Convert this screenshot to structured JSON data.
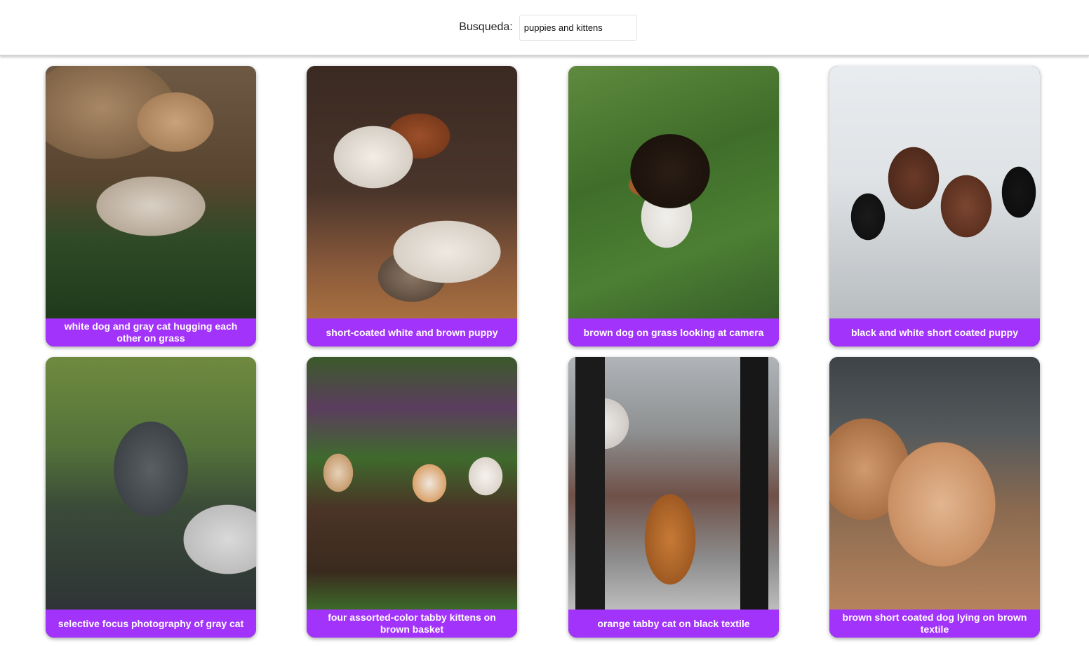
{
  "search": {
    "label": "Busqueda:",
    "value": "puppies and kittens"
  },
  "cards": [
    {
      "caption": "white dog and gray cat hugging each other on grass"
    },
    {
      "caption": "short-coated white and brown puppy"
    },
    {
      "caption": "brown dog on grass looking at camera"
    },
    {
      "caption": "black and white short coated puppy"
    },
    {
      "caption": "selective focus photography of gray cat"
    },
    {
      "caption": "four assorted-color tabby kittens on brown basket"
    },
    {
      "caption": "orange tabby cat on black textile"
    },
    {
      "caption": "brown short coated dog lying on brown textile"
    }
  ],
  "colors": {
    "caption_bg": "#a233fa",
    "caption_text": "#ffffff"
  }
}
